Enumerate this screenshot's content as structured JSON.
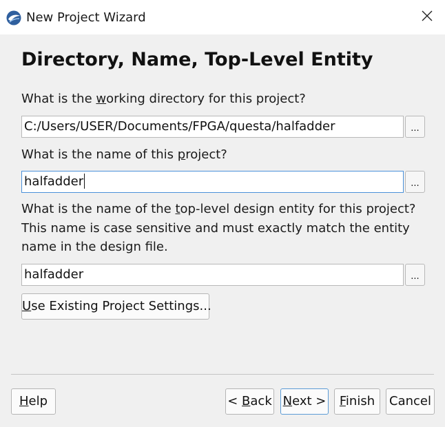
{
  "window": {
    "title": "New Project Wizard",
    "app_icon": "quartus-globe-icon",
    "close_icon": "close-icon"
  },
  "page": {
    "heading": "Directory, Name, Top-Level Entity"
  },
  "working_directory": {
    "label_pre": "What is the ",
    "label_key": "w",
    "label_post": "orking directory for this project?",
    "value": "C:/Users/USER/Documents/FPGA/questa/halfadder",
    "browse_label": "..."
  },
  "project_name": {
    "label_pre": "What is the name of this ",
    "label_key": "p",
    "label_post": "roject?",
    "value": "halfadder",
    "browse_label": "..."
  },
  "top_level_entity": {
    "label_line1_pre": "What is the name of the ",
    "label_line1_key": "t",
    "label_line1_post": "op-level design entity for this project?",
    "label_line2": "This name is case sensitive and must exactly match the entity",
    "label_line3": "name in the design file.",
    "value": "halfadder",
    "browse_label": "..."
  },
  "existing_settings_button": {
    "key": "U",
    "rest": "se Existing Project Settings..."
  },
  "footer": {
    "help": {
      "key": "H",
      "rest": "elp"
    },
    "back": {
      "pre": "< ",
      "key": "B",
      "rest": "ack"
    },
    "next": {
      "key": "N",
      "rest": "ext >"
    },
    "finish": {
      "key": "F",
      "rest": "inish"
    },
    "cancel": {
      "label": "Cancel"
    }
  },
  "colors": {
    "background": "#f0f0f0",
    "titlebar": "#ffffff",
    "focus_border": "#4a90d9",
    "default_button_border": "#5b9bd5"
  }
}
